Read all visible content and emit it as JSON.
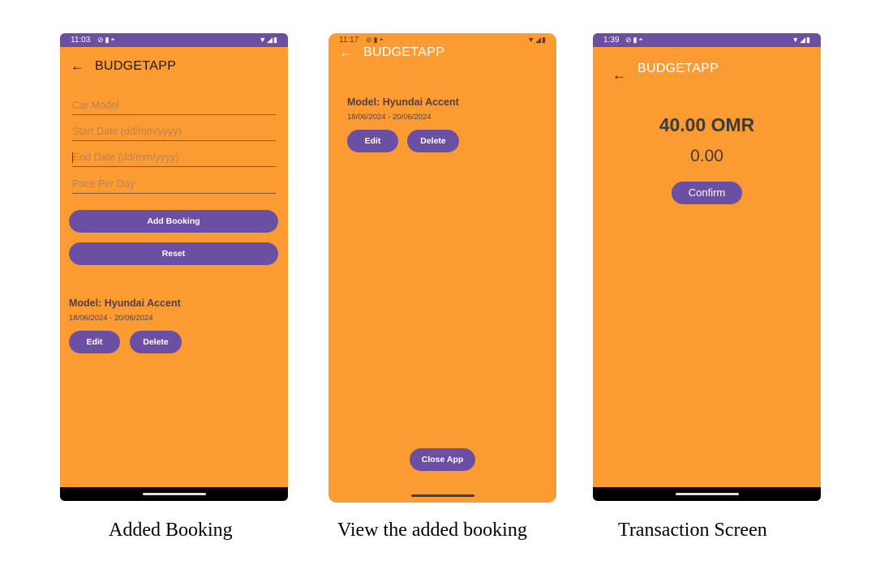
{
  "app_title": "BUDGETAPP",
  "screens": [
    {
      "time": "11:03",
      "form": {
        "car_model_placeholder": "Car Model",
        "start_date_placeholder": "Start Date (dd/mm/yyyy)",
        "end_date_placeholder": "End Date (dd/mm/yyyy)",
        "price_placeholder": "Price Per Day"
      },
      "add_button": "Add Booking",
      "reset_button": "Reset",
      "booking": {
        "model": "Model: Hyundai Accent",
        "dates": "18/06/2024 - 20/06/2024",
        "edit": "Edit",
        "delete": "Delete"
      },
      "caption": "Added Booking"
    },
    {
      "time": "11:17",
      "booking": {
        "model": "Model: Hyundai Accent",
        "dates": "18/06/2024 - 20/06/2024",
        "edit": "Edit",
        "delete": "Delete"
      },
      "close_button": "Close App",
      "caption": "View the added booking"
    },
    {
      "time": "1:39",
      "total": "40.00 OMR",
      "secondary": "0.00",
      "confirm_button": "Confirm",
      "caption": "Transaction Screen"
    }
  ],
  "icons": {
    "status_left": [
      "vpn-icon",
      "sim-icon",
      "sync-icon"
    ],
    "status_right": [
      "wifi-icon",
      "signal-icon",
      "battery-icon"
    ],
    "back": "back-arrow-icon"
  },
  "colors": {
    "background": "#fd9b33",
    "accent": "#6a4fa3",
    "text_dark": "#4a4050"
  }
}
